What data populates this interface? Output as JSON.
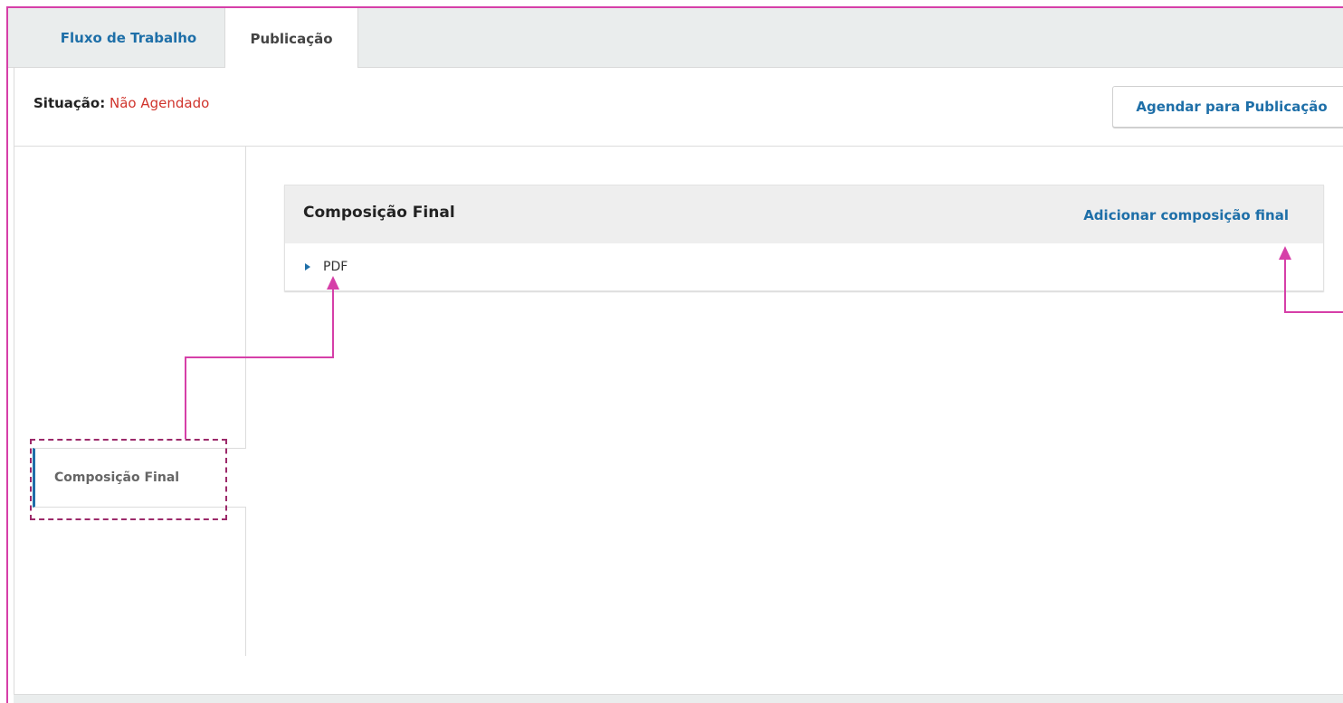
{
  "tabs": [
    {
      "label": "Fluxo de Trabalho",
      "active": false
    },
    {
      "label": "Publicação",
      "active": true
    }
  ],
  "status": {
    "label": "Situação:",
    "value": "Não Agendado"
  },
  "schedule_button": {
    "label": "Agendar para Publicação"
  },
  "sidebar": {
    "items": [
      {
        "label": "Composição Final",
        "active": true
      }
    ]
  },
  "galley_panel": {
    "title": "Composição Final",
    "action_label": "Adicionar composição final",
    "items": [
      {
        "label": "PDF"
      }
    ]
  },
  "icons": {
    "row_toggle": "triangle-right-icon"
  },
  "colors": {
    "accent": "#1e6fa8",
    "status": "#d0342c",
    "annotation": "#d63fa8",
    "annotation_box": "#9c2a6a"
  }
}
